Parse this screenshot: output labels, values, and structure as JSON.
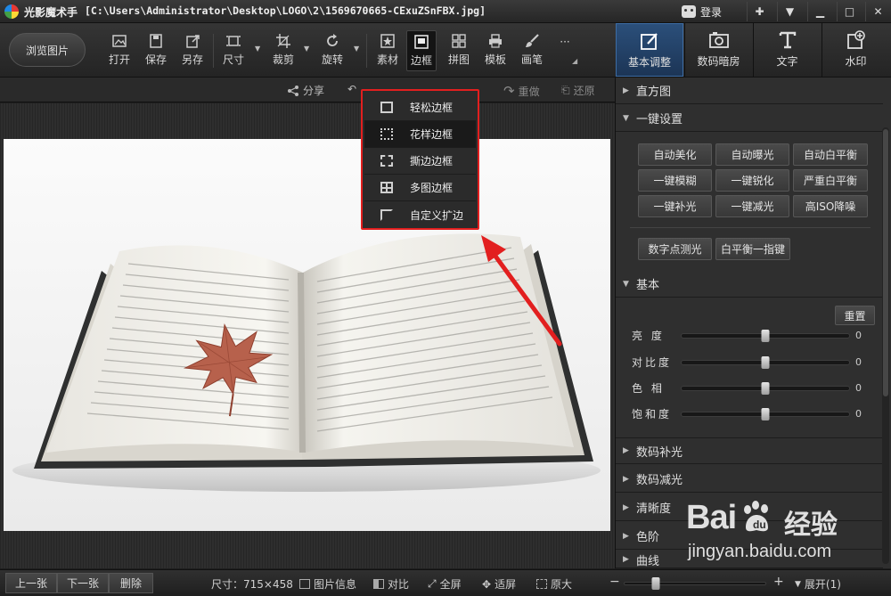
{
  "titlebar": {
    "app_name": "光影魔术手",
    "path": "[C:\\Users\\Administrator\\Desktop\\LOGO\\2\\1569670665-CExuZSnFBX.jpg]",
    "login_label": "登录"
  },
  "toolbar": {
    "browse_label": "浏览图片",
    "tools": {
      "open": "打开",
      "save": "保存",
      "saveas": "另存",
      "size": "尺寸",
      "crop": "裁剪",
      "rotate": "旋转",
      "material": "素材",
      "border": "边框",
      "collage": "拼图",
      "template": "模板",
      "brush": "画笔",
      "more": "···"
    },
    "right_tabs": {
      "basic": "基本调整",
      "darkroom": "数码暗房",
      "text": "文字",
      "watermark": "水印"
    }
  },
  "subbar": {
    "share": "分享",
    "redo": "重做",
    "restore": "还原"
  },
  "border_menu": {
    "items": [
      "轻松边框",
      "花样边框",
      "撕边边框",
      "多图边框",
      "自定义扩边"
    ]
  },
  "panel": {
    "histogram": "直方图",
    "one_click": "一键设置",
    "buttons_row1": [
      "自动美化",
      "自动曝光",
      "自动白平衡"
    ],
    "buttons_row2": [
      "一键模糊",
      "一键锐化",
      "严重白平衡"
    ],
    "buttons_row3": [
      "一键补光",
      "一键减光",
      "高ISO降噪"
    ],
    "buttons_row4": [
      "数字点测光",
      "白平衡一指键"
    ],
    "basic": "基本",
    "reset": "重置",
    "sliders": [
      {
        "label": "亮 度",
        "value": 0,
        "level": 0.5
      },
      {
        "label": "对比度",
        "value": 0,
        "level": 0.5
      },
      {
        "label": "色 相",
        "value": 0,
        "level": 0.5
      },
      {
        "label": "饱和度",
        "value": 0,
        "level": 0.5
      }
    ],
    "sections": [
      "数码补光",
      "数码减光",
      "清晰度",
      "色阶",
      "曲线"
    ]
  },
  "bottombar": {
    "prev": "上一张",
    "next": "下一张",
    "delete": "删除",
    "size": "尺寸：715×458",
    "info": "图片信息",
    "compare": "对比",
    "fullscreen": "全屏",
    "fit": "适屏",
    "original": "原大",
    "zoom_level": 0.22,
    "expand": "展开(1)"
  },
  "watermark": {
    "brand": "Bai",
    "brand_cn": "经验",
    "url": "jingyan.baidu.com"
  },
  "colors": {
    "highlight_red": "#e21f1f",
    "active_tab": "#2b4f7a"
  }
}
